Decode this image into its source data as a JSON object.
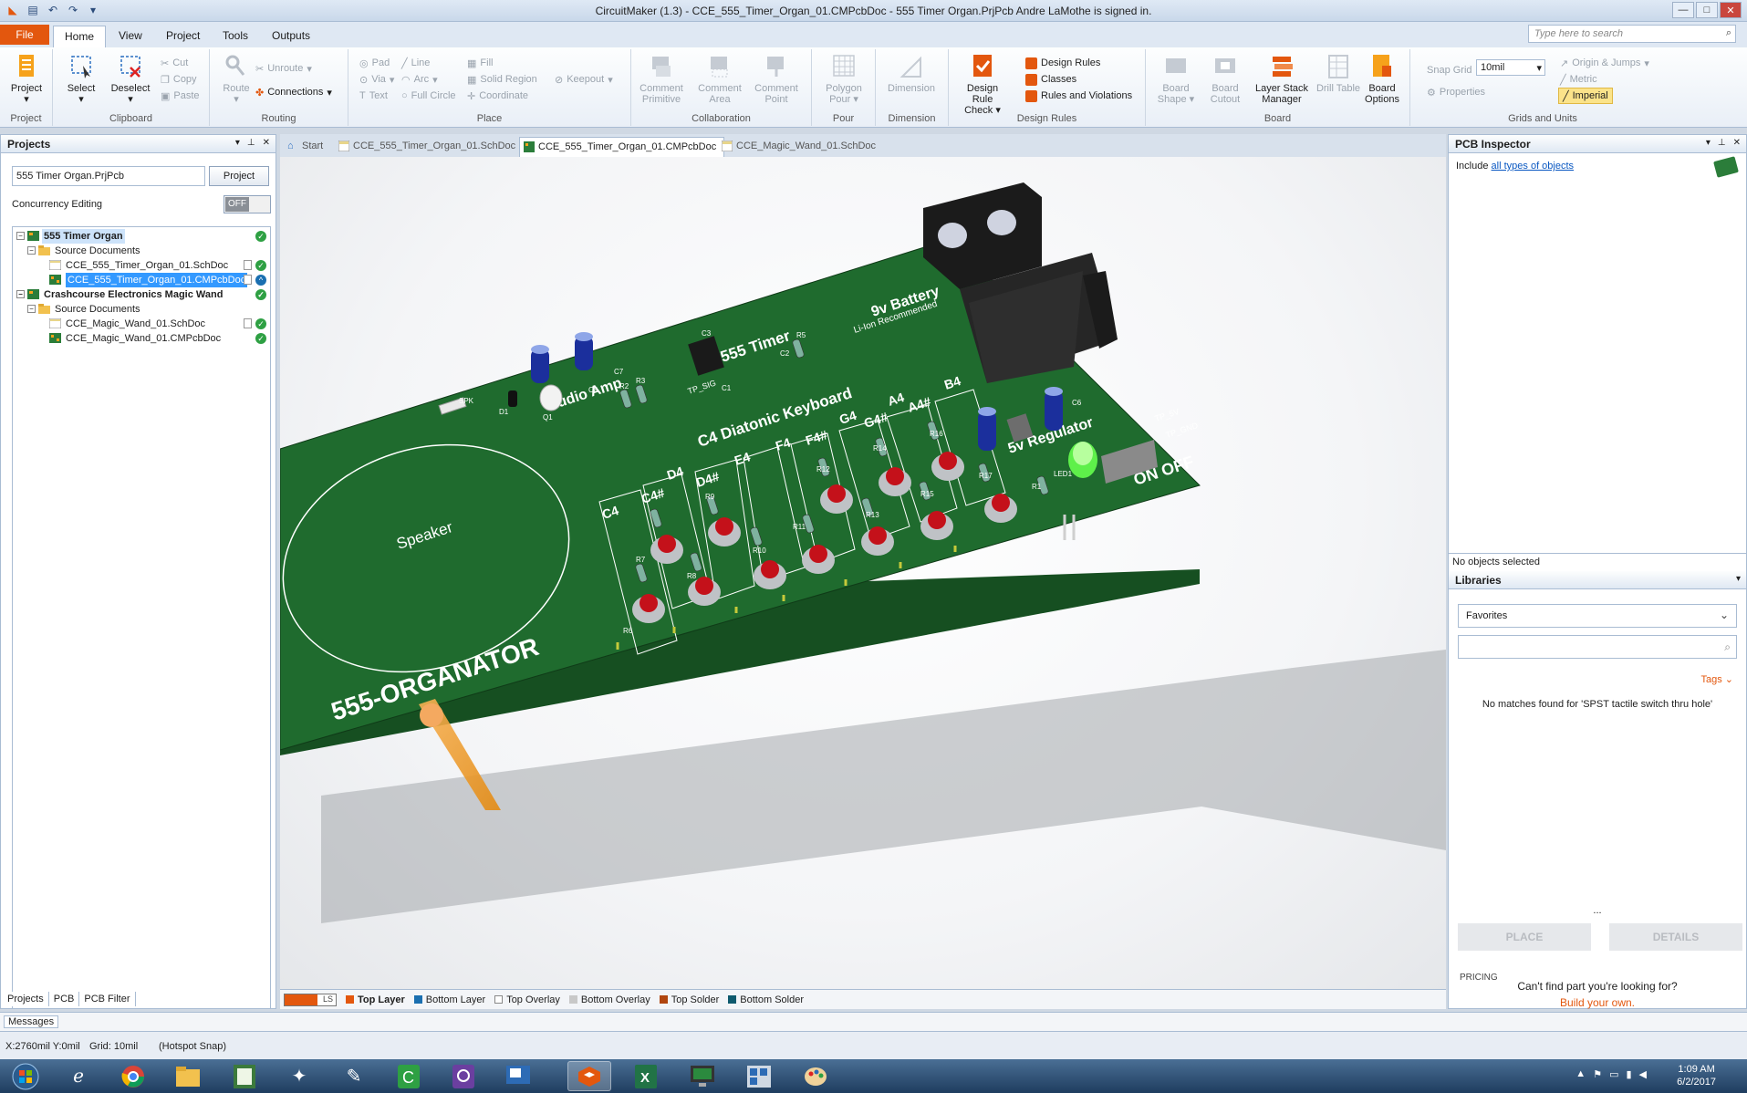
{
  "window": {
    "title": "CircuitMaker (1.3) - CCE_555_Timer_Organ_01.CMPcbDoc - 555 Timer Organ.PrjPcb Andre LaMothe is signed in."
  },
  "ribbon_tabs": [
    "File",
    "Home",
    "View",
    "Project",
    "Tools",
    "Outputs"
  ],
  "search_placeholder": "Type here to search",
  "groups": {
    "project": {
      "label": "Project",
      "btn": "Project"
    },
    "clipboard": {
      "label": "Clipboard",
      "select": "Select",
      "deselect": "Deselect",
      "cut": "Cut",
      "copy": "Copy",
      "paste": "Paste"
    },
    "routing": {
      "label": "Routing",
      "route": "Route",
      "unroute": "Unroute",
      "connections": "Connections"
    },
    "place": {
      "label": "Place",
      "pad": "Pad",
      "via": "Via",
      "text": "Text",
      "line": "Line",
      "arc": "Arc",
      "full_circle": "Full Circle",
      "fill": "Fill",
      "solid_region": "Solid Region",
      "coordinate": "Coordinate",
      "keepout": "Keepout"
    },
    "collaboration": {
      "label": "Collaboration",
      "b1": "Comment Primitive",
      "b2": "Comment Area",
      "b3": "Comment Point"
    },
    "pour": {
      "label": "Pour",
      "b1": "Polygon Pour"
    },
    "dimension": {
      "label": "Dimension",
      "b1": "Dimension"
    },
    "design_rules": {
      "label": "Design Rules",
      "drc": "Design Rule Check",
      "rules": "Design Rules",
      "classes": "Classes",
      "violations": "Rules and Violations"
    },
    "board": {
      "label": "Board",
      "b1": "Board Shape",
      "b2": "Board Cutout",
      "b3": "Layer Stack Manager",
      "b4": "Drill Table",
      "b5": "Board Options"
    },
    "grids": {
      "label": "Grids and Units",
      "snap_label": "Snap Grid",
      "snap_value": "10mil",
      "properties": "Properties",
      "origin": "Origin & Jumps",
      "metric": "Metric",
      "imperial": "Imperial"
    }
  },
  "projects_panel": {
    "title": "Projects",
    "project_name": "555 Timer Organ.PrjPcb",
    "project_btn": "Project",
    "concurrency_label": "Concurrency Editing",
    "toggle": "OFF",
    "tree": [
      {
        "label": "555 Timer Organ",
        "level": 0
      },
      {
        "label": "Source Documents",
        "level": 1
      },
      {
        "label": "CCE_555_Timer_Organ_01.SchDoc",
        "level": 2
      },
      {
        "label": "CCE_555_Timer_Organ_01.CMPcbDoc",
        "level": 2
      },
      {
        "label": "Crashcourse Electronics Magic Wand",
        "level": 0
      },
      {
        "label": "Source Documents",
        "level": 1
      },
      {
        "label": "CCE_Magic_Wand_01.SchDoc",
        "level": 2
      },
      {
        "label": "CCE_Magic_Wand_01.CMPcbDoc",
        "level": 2
      }
    ],
    "bottom_tabs": [
      "Projects",
      "PCB",
      "PCB Filter"
    ]
  },
  "doc_tabs": [
    "Start",
    "CCE_555_Timer_Organ_01.SchDoc",
    "CCE_555_Timer_Organ_01.CMPcbDoc",
    "CCE_Magic_Wand_01.SchDoc"
  ],
  "pcb": {
    "title": "555-ORGANATOR",
    "speaker": "Speaker",
    "timer": "555 Timer",
    "battery": "9v Battery",
    "battery_note": "Li-Ion Recommended",
    "keyboard": "C4 Diatonic Keyboard",
    "amp": "Audio Amp",
    "regulator": "5v Regulator",
    "power": "ON  OFF",
    "tp5v": "TP_5V",
    "tpgnd": "TP_GND",
    "tpsig": "TP_SIG",
    "notes": [
      "C4",
      "C4#",
      "D4",
      "D4#",
      "E4",
      "F4",
      "F4#",
      "G4",
      "G4#",
      "A4",
      "A4#",
      "B4"
    ],
    "refs": [
      "R7",
      "R6",
      "R9",
      "R8",
      "R10",
      "R11",
      "R12",
      "R13",
      "R14",
      "R15",
      "R16",
      "R17",
      "R1",
      "R2",
      "R3",
      "R5",
      "C1",
      "C2",
      "C3",
      "C6",
      "C7",
      "C8",
      "D1",
      "Q1",
      "SPK",
      "LED1"
    ],
    "colors": {
      "board": "#1f6b2e",
      "board_edge": "#164f21",
      "silk": "#ffffff",
      "button": "#c4111a",
      "cap": "#1b2f9c"
    }
  },
  "layers": {
    "ls": "LS",
    "items": [
      {
        "name": "Top Layer",
        "color": "#e3570e"
      },
      {
        "name": "Bottom Layer",
        "color": "#1a6fb0"
      },
      {
        "name": "Top Overlay",
        "color": "#ffffff"
      },
      {
        "name": "Bottom Overlay",
        "color": "#c8c8c8"
      },
      {
        "name": "Top Solder",
        "color": "#b1460f"
      },
      {
        "name": "Bottom Solder",
        "color": "#0e5a6e"
      }
    ]
  },
  "inspector": {
    "title": "PCB Inspector",
    "include_prefix": "Include",
    "include_link": "all types of objects",
    "no_objects": "No objects selected"
  },
  "libraries": {
    "title": "Libraries",
    "favorites": "Favorites",
    "tags": "Tags",
    "no_match": "No matches found for 'SPST tactile switch thru hole'",
    "dots": "...",
    "place": "PLACE",
    "details": "DETAILS",
    "pricing": "PRICING",
    "cant_find": "Can't find part you're looking for?",
    "build_own": "Build your own."
  },
  "messages_tab": "Messages",
  "status": {
    "coords": "X:2760mil Y:0mil",
    "grid": "Grid: 10mil",
    "snap": "(Hotspot Snap)"
  },
  "taskbar": {
    "time": "1:09 AM",
    "date": "6/2/2017"
  }
}
